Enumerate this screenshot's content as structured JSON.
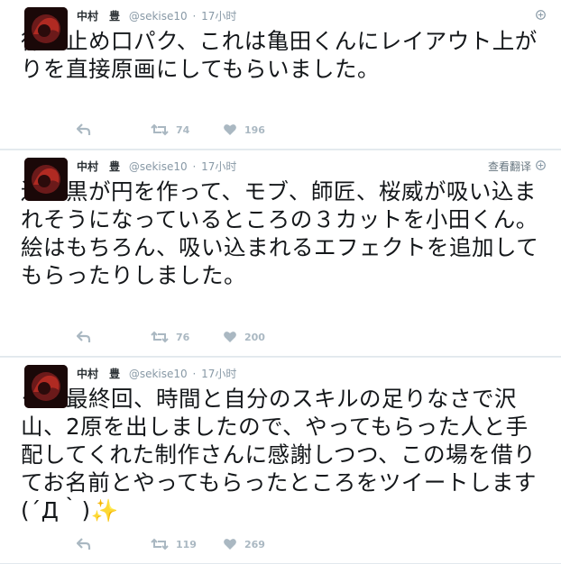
{
  "tweets": [
    {
      "name": "中村　豊",
      "handle": "@sekise10",
      "sep": "·",
      "time": "17小时",
      "translate": "",
      "text": "律の止め口パク、これは亀田くんにレイアウト上がりを直接原画にしてもらいました。",
      "retweets": "74",
      "likes": "196"
    },
    {
      "name": "中村　豊",
      "handle": "@sekise10",
      "sep": "·",
      "time": "17小时",
      "translate": "查看翻译",
      "text": "遺志黒が円を作って、モブ、師匠、桜威が吸い込まれそうになっているところの３カットを小田くん。\n絵はもちろん、吸い込まれるエフェクトを追加してもらったりしました。",
      "retweets": "76",
      "likes": "200"
    },
    {
      "name": "中村　豊",
      "handle": "@sekise10",
      "sep": "·",
      "time": "17小时",
      "translate": "",
      "text": "モブ最終回、時間と自分のスキルの足りなさで沢山、2原を出しましたので、やってもらった人と手配してくれた制作さんに感謝しつつ、この場を借りてお名前とやってもらったところをツイートします(´Д｀)✨",
      "retweets": "119",
      "likes": "269"
    }
  ],
  "colors": {
    "text": "#14171a",
    "meta": "#8899a6",
    "icon": "#aab8c2",
    "background": "#e6ecf0"
  },
  "icons": [
    "avatar",
    "caret-icon",
    "globe-icon",
    "reply-icon",
    "retweet-icon",
    "heart-icon"
  ]
}
